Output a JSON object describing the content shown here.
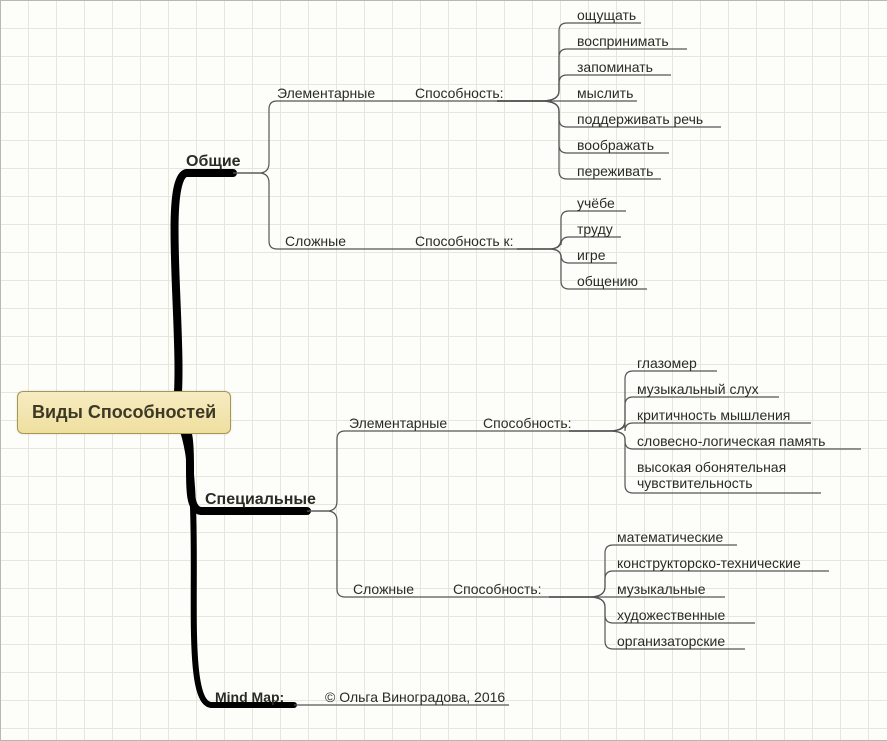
{
  "diagram": {
    "root": "Виды Способностей",
    "branches": {
      "general": {
        "label": "Общие",
        "elementary": {
          "label": "Элементарные",
          "ability_label": "Способность:",
          "items": [
            "ощущать",
            "воспринимать",
            "запоминать",
            "мыслить",
            "поддерживать речь",
            "воображать",
            "переживать"
          ]
        },
        "complex": {
          "label": "Сложные",
          "ability_label": "Способность к:",
          "items": [
            "учёбе",
            "труду",
            "игре",
            "общению"
          ]
        }
      },
      "special": {
        "label": "Специальные",
        "elementary": {
          "label": "Элементарные",
          "ability_label": "Способность:",
          "items": [
            "глазомер",
            "музыкальный слух",
            "критичность мышления",
            "словесно-логическая память",
            "высокая обонятельная чувствительность"
          ]
        },
        "complex": {
          "label": "Сложные",
          "ability_label": "Способность:",
          "items": [
            "математические",
            "конструкторско-технические",
            "музыкальные",
            "художественные",
            "организаторские"
          ]
        }
      },
      "mindmap": {
        "label": "Mind Map:",
        "credit": "© Ольга Виноградова, 2016"
      }
    }
  }
}
